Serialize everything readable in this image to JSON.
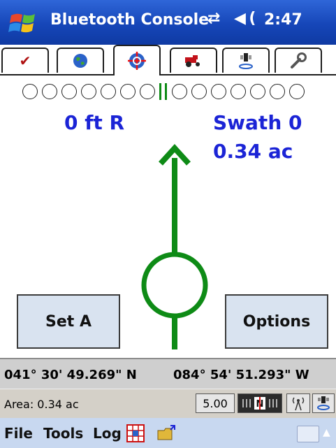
{
  "titlebar": {
    "title": "Bluetooth Console",
    "connection_icon": "sync-arrows-icon",
    "volume_icon": "speaker-icon",
    "time": "2:47"
  },
  "tabs": [
    {
      "icon": "checklist-icon",
      "glyph": "☑",
      "active": false
    },
    {
      "icon": "globe-icon",
      "glyph": "🌐",
      "active": false
    },
    {
      "icon": "gps-target-icon",
      "glyph": "✜",
      "active": true
    },
    {
      "icon": "tractor-icon",
      "glyph": "🚜",
      "active": false
    },
    {
      "icon": "antenna-icon",
      "glyph": "📡",
      "active": false
    },
    {
      "icon": "wrench-icon",
      "glyph": "🔧",
      "active": false
    }
  ],
  "guidance": {
    "offset": "0 ft R",
    "swath": "Swath 0",
    "area": "0.34 ac",
    "left_leds": 7,
    "right_leds": 7,
    "colors": {
      "line": "#0e8b16",
      "text": "#1b24d6"
    }
  },
  "buttons": {
    "set_a": "Set A",
    "options": "Options"
  },
  "coordinates": {
    "lat": "041° 30' 49.269\" N",
    "lon": "084° 54' 51.293\" W"
  },
  "status": {
    "area": "Area: 0.34 ac",
    "zoom": "5.00",
    "nav_icon": "north-indicator-icon",
    "signal_icon": "signal-tower-icon",
    "receiver_icon": "receiver-icon"
  },
  "menu": {
    "file": "File",
    "tools": "Tools",
    "log": "Log",
    "grid_icon": "grid-log-icon",
    "folder_icon": "folder-open-icon"
  }
}
